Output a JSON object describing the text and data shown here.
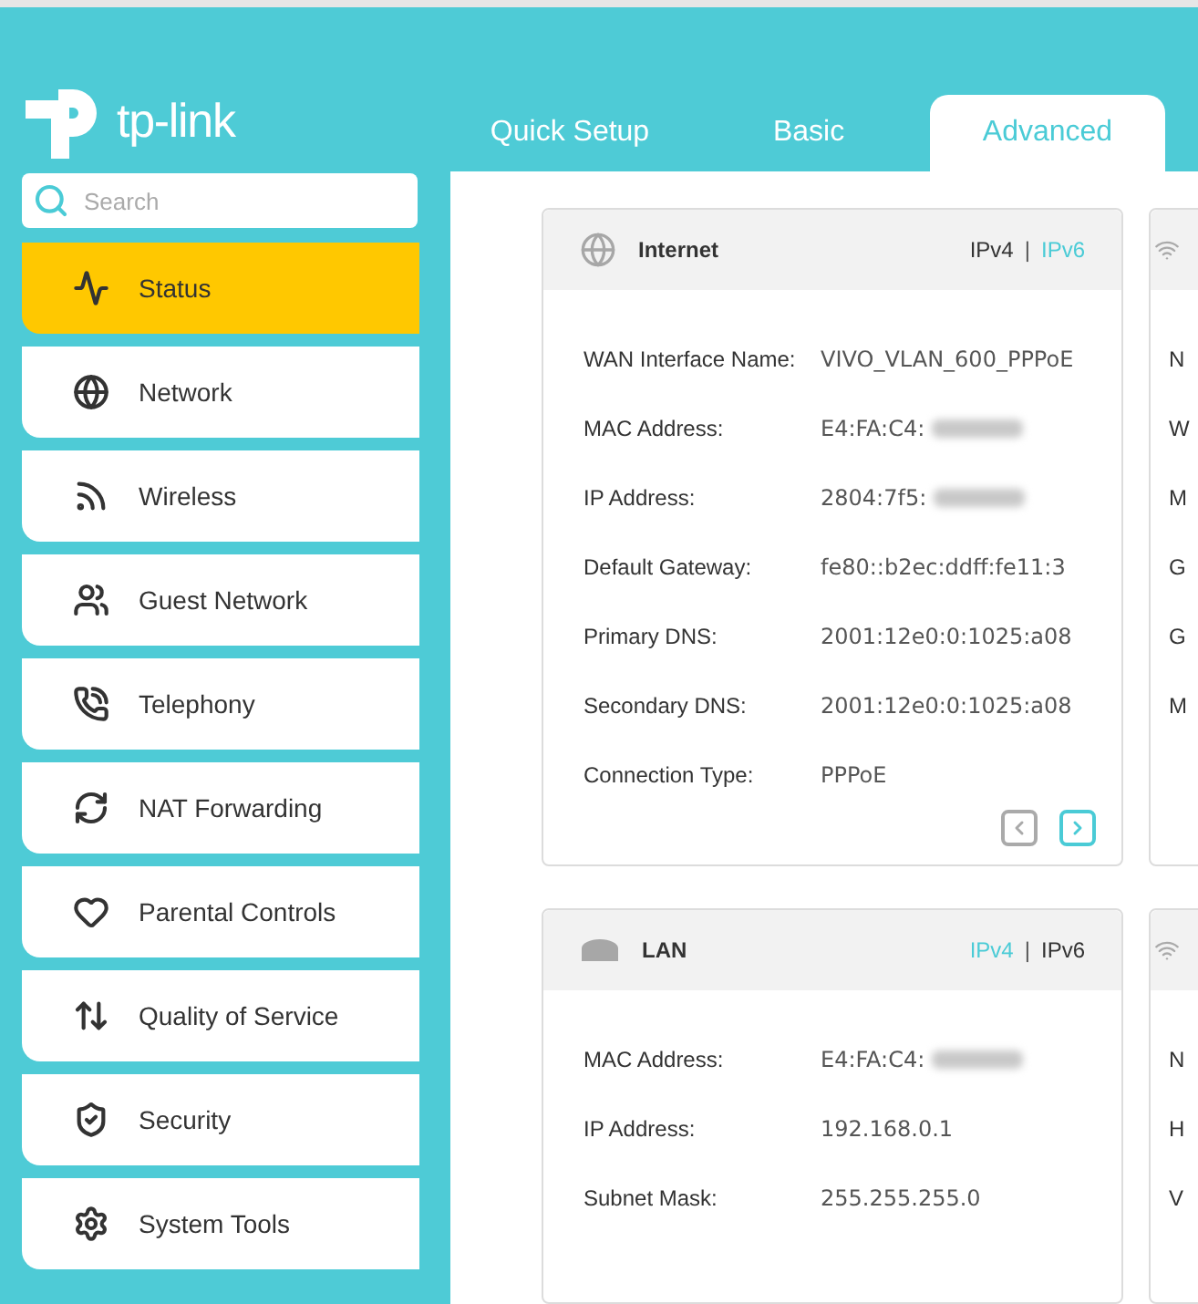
{
  "logo": {
    "text": "tp-link"
  },
  "tabs": [
    {
      "label": "Quick Setup",
      "selected": false
    },
    {
      "label": "Basic",
      "selected": false
    },
    {
      "label": "Advanced",
      "selected": true
    }
  ],
  "search": {
    "placeholder": "Search"
  },
  "sidebar": {
    "items": [
      {
        "label": "Status",
        "selected": true
      },
      {
        "label": "Network",
        "selected": false
      },
      {
        "label": "Wireless",
        "selected": false
      },
      {
        "label": "Guest Network",
        "selected": false
      },
      {
        "label": "Telephony",
        "selected": false
      },
      {
        "label": "NAT Forwarding",
        "selected": false
      },
      {
        "label": "Parental Controls",
        "selected": false
      },
      {
        "label": "Quality of Service",
        "selected": false
      },
      {
        "label": "Security",
        "selected": false
      },
      {
        "label": "System Tools",
        "selected": false
      }
    ]
  },
  "cards": [
    {
      "title": "Internet",
      "separator": "|",
      "modes": [
        {
          "label": "IPv4",
          "selected": false
        },
        {
          "label": "IPv6",
          "selected": true
        }
      ],
      "rows": [
        {
          "label": "WAN Interface Name:",
          "value": "VIVO_VLAN_600_PPPoE",
          "blurred": false
        },
        {
          "label": "MAC Address:",
          "value": "E4:FA:C4:",
          "blurred": true
        },
        {
          "label": "IP Address:",
          "value": "2804:7f5:",
          "blurred": true
        },
        {
          "label": "Default Gateway:",
          "value": "fe80::b2ec:ddff:fe11:3",
          "blurred": false
        },
        {
          "label": "Primary DNS:",
          "value": "2001:12e0:0:1025:a08",
          "blurred": false
        },
        {
          "label": "Secondary DNS:",
          "value": "2001:12e0:0:1025:a08",
          "blurred": false
        },
        {
          "label": "Connection Type:",
          "value": "PPPoE",
          "blurred": false
        }
      ],
      "pager": [
        {
          "disabled": true
        },
        {
          "disabled": false
        }
      ],
      "side_card": {
        "labels": [
          "N",
          "W",
          "M",
          "G",
          "G",
          "M"
        ]
      }
    },
    {
      "title": "LAN",
      "separator": "|",
      "modes": [
        {
          "label": "IPv4",
          "selected": true
        },
        {
          "label": "IPv6",
          "selected": false
        }
      ],
      "rows": [
        {
          "label": "MAC Address:",
          "value": "E4:FA:C4:",
          "blurred": true
        },
        {
          "label": "IP Address:",
          "value": "192.168.0.1",
          "blurred": false
        },
        {
          "label": "Subnet Mask:",
          "value": "255.255.255.0",
          "blurred": false
        }
      ],
      "side_card": {
        "labels": [
          "N",
          "H",
          "V"
        ]
      }
    }
  ]
}
